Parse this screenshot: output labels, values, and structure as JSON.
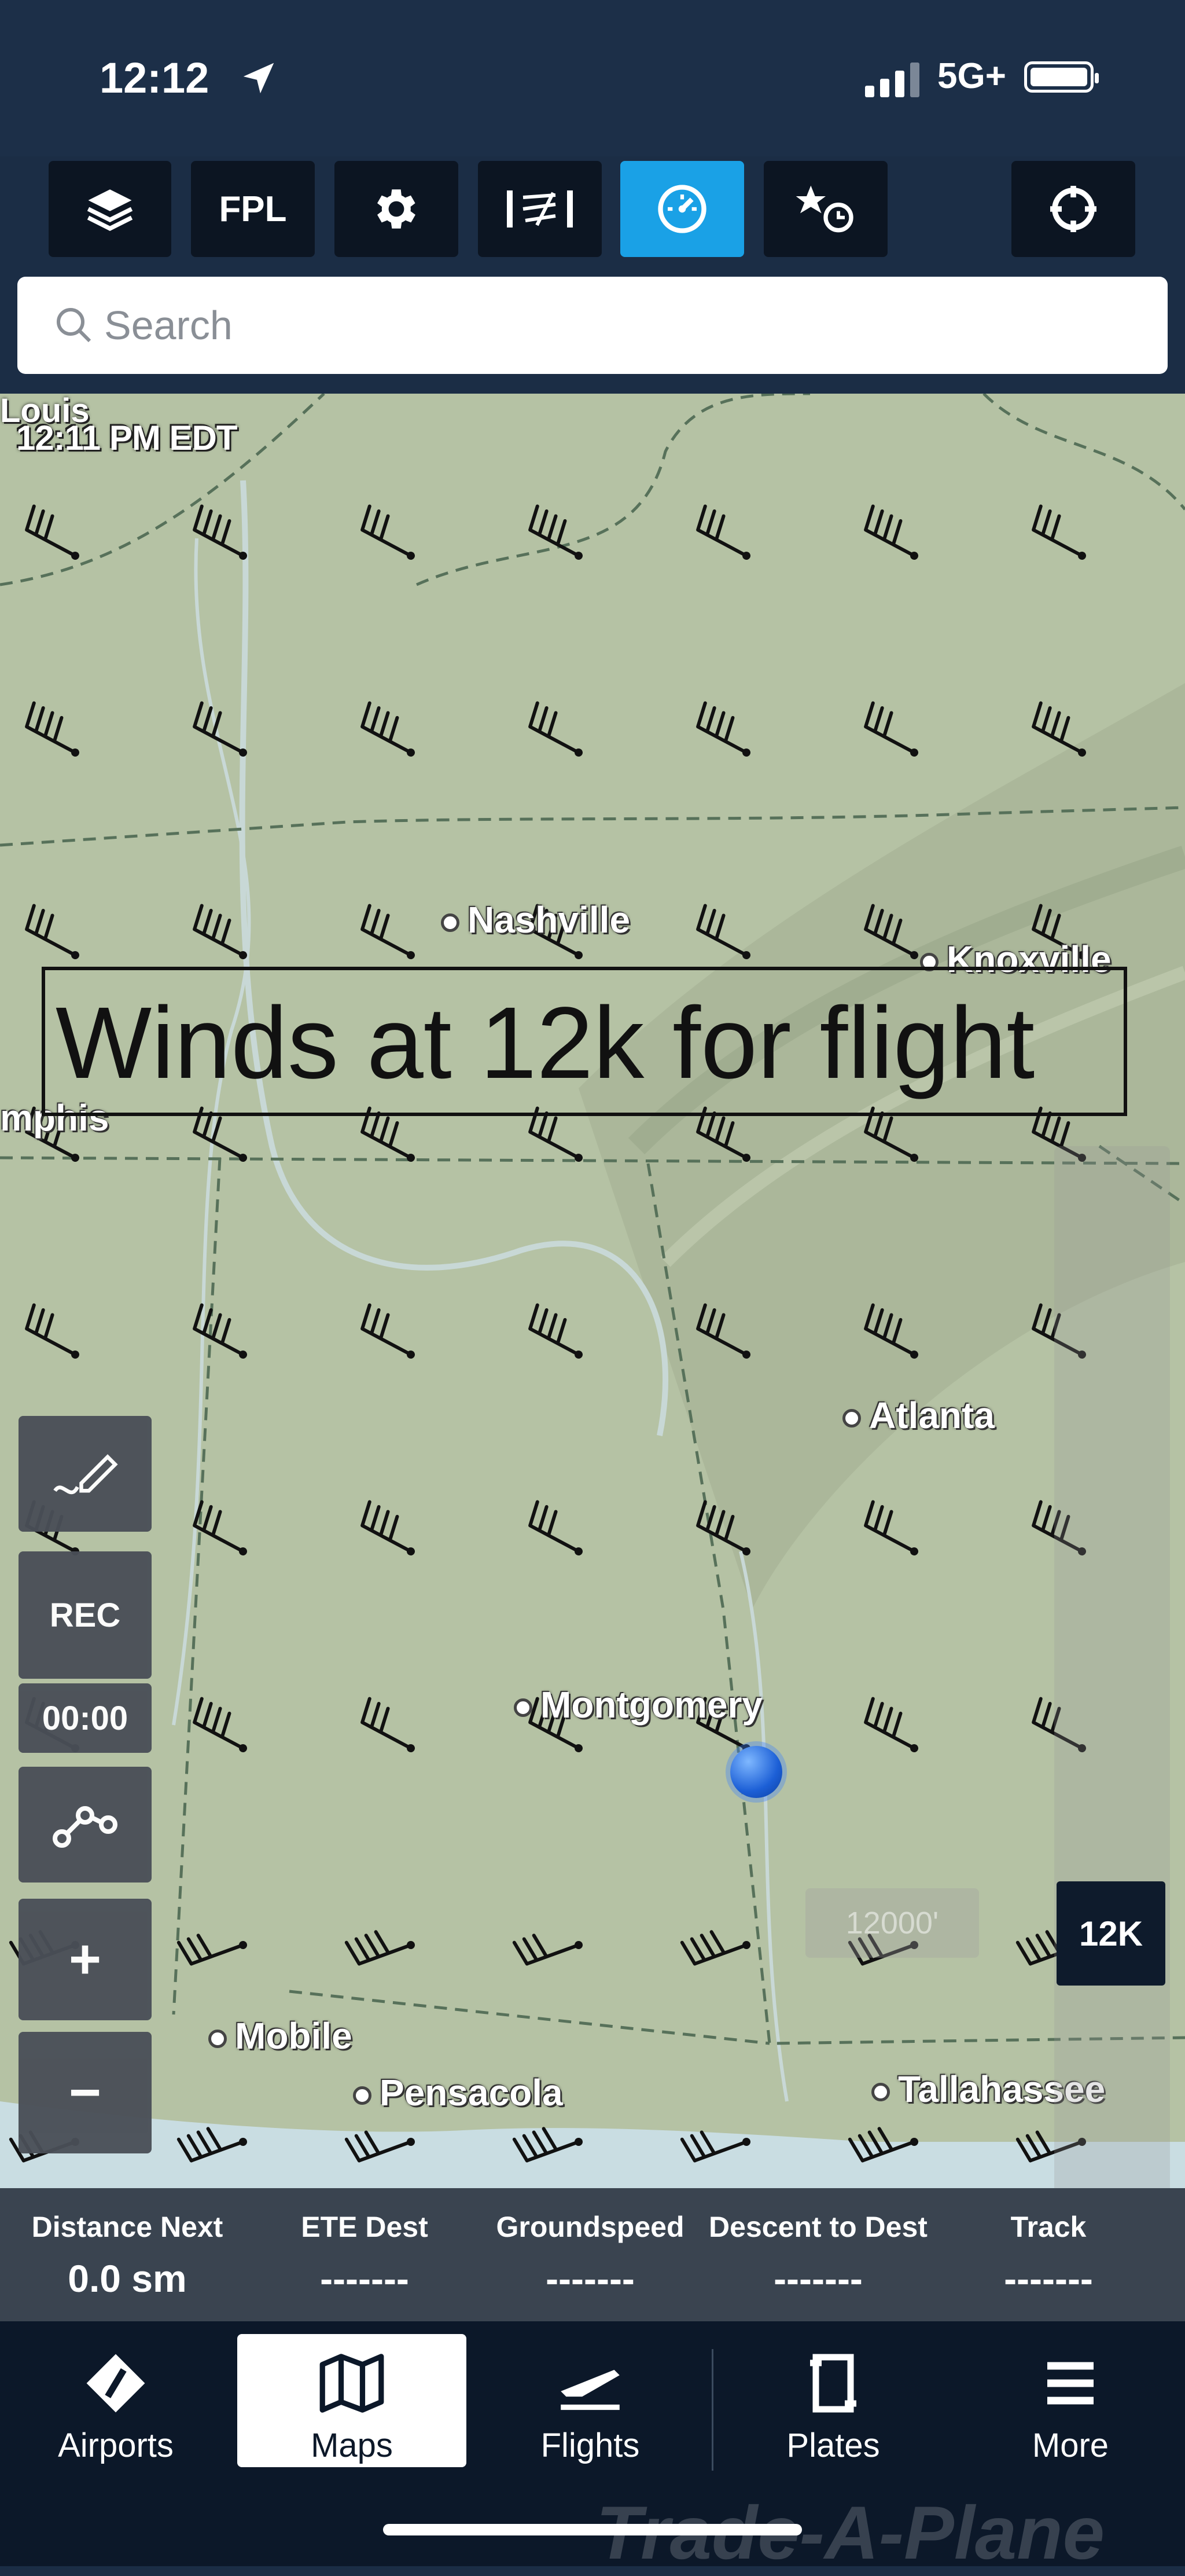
{
  "status_bar": {
    "time": "12:12",
    "network": "5G+"
  },
  "toolbar": {
    "buttons": [
      {
        "name": "layers",
        "icon": "layers-icon"
      },
      {
        "name": "fpl",
        "label": "FPL"
      },
      {
        "name": "settings",
        "icon": "gear-icon"
      },
      {
        "name": "procedure",
        "icon": "procedure-icon"
      },
      {
        "name": "instruments",
        "icon": "gauge-icon",
        "active": true
      },
      {
        "name": "favorites",
        "icon": "star-clock-icon"
      },
      {
        "name": "locate",
        "icon": "crosshair-icon"
      }
    ],
    "active_color": "#1aa1e6"
  },
  "search": {
    "placeholder": "Search"
  },
  "map": {
    "timestamp": "12:11 PM EDT",
    "partial_labels": {
      "louis": "Louis",
      "memphis": "mphis"
    },
    "cities": {
      "nashville": "Nashville",
      "knoxville": "Knoxville",
      "atlanta": "Atlanta",
      "montgomery": "Montgomery",
      "mobile": "Mobile",
      "pensacola": "Pensacola",
      "tallahassee": "Tallahassee"
    },
    "annotation": "Winds at 12k for flight",
    "altitude": {
      "selected": "12K",
      "ghost": "12000'"
    },
    "side_controls": {
      "record": "REC",
      "timer": "00:00",
      "zoom_in": "+",
      "zoom_out": "−"
    }
  },
  "instruments": [
    {
      "label": "Distance Next",
      "value": "0.0 sm"
    },
    {
      "label": "ETE Dest",
      "value": "-------"
    },
    {
      "label": "Groundspeed",
      "value": "-------"
    },
    {
      "label": "Descent to Dest",
      "value": "-------"
    },
    {
      "label": "Track",
      "value": "-------"
    }
  ],
  "tabs": [
    {
      "label": "Airports",
      "icon": "airport-icon"
    },
    {
      "label": "Maps",
      "icon": "map-icon",
      "selected": true
    },
    {
      "label": "Flights",
      "icon": "plane-icon"
    },
    {
      "label": "Plates",
      "icon": "plate-icon"
    },
    {
      "label": "More",
      "icon": "menu-icon"
    }
  ],
  "watermark": "Trade-A-Plane"
}
